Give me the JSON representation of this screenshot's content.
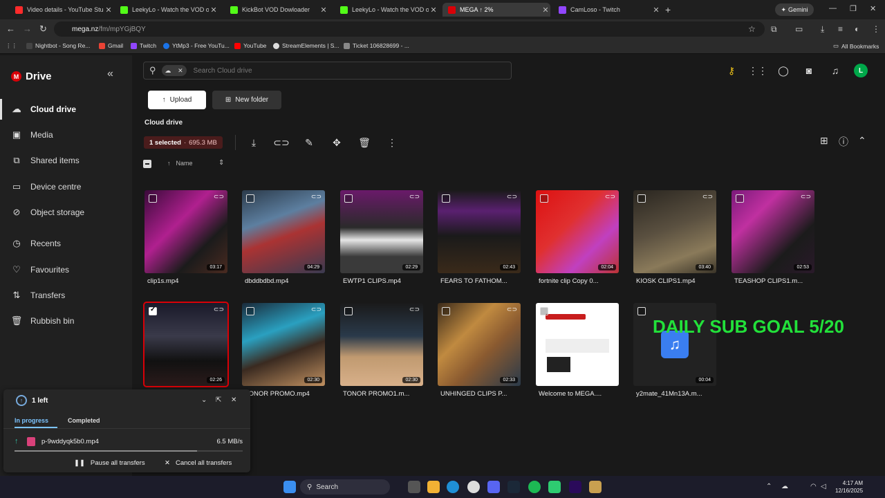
{
  "browser": {
    "tabs": [
      {
        "title": "Video details - YouTube Studio",
        "color": "#ff2b2b"
      },
      {
        "title": "LeekyLo - Watch the VOD on K",
        "color": "#53fc18"
      },
      {
        "title": "KickBot VOD Dowloader",
        "color": "#53fc18"
      },
      {
        "title": "LeekyLo - Watch the VOD on K",
        "color": "#53fc18"
      },
      {
        "title": "MEGA ↑ 2%",
        "color": "#d90007"
      },
      {
        "title": "CamLoso - Twitch",
        "color": "#9146ff"
      }
    ],
    "gemini_label": "Gemini",
    "url_host": "mega.nz",
    "url_path": "/fm/mpYGjBQY",
    "bookmarks": [
      {
        "label": "Nightbot - Song Re...",
        "color": "#2d2d2d"
      },
      {
        "label": "Gmail",
        "color": "#ea4335"
      },
      {
        "label": "Twitch",
        "color": "#9146ff"
      },
      {
        "label": "YtMp3 - Free YouTu...",
        "color": "#1a73e8"
      },
      {
        "label": "YouTube",
        "color": "#ff0000"
      },
      {
        "label": "StreamElements | S...",
        "color": "#ddd"
      },
      {
        "label": "Ticket 106828699 - ...",
        "color": "#888"
      }
    ],
    "all_bookmarks": "All Bookmarks"
  },
  "sidebar": {
    "brand": "Drive",
    "items": [
      {
        "label": "Cloud drive",
        "icon": "cloud-icon"
      },
      {
        "label": "Media",
        "icon": "image-icon"
      },
      {
        "label": "Shared items",
        "icon": "shared-icon"
      },
      {
        "label": "Device centre",
        "icon": "device-icon"
      },
      {
        "label": "Object storage",
        "icon": "storage-icon"
      },
      {
        "label": "Recents",
        "icon": "clock-icon"
      },
      {
        "label": "Favourites",
        "icon": "heart-icon"
      },
      {
        "label": "Transfers",
        "icon": "transfer-icon"
      },
      {
        "label": "Rubbish bin",
        "icon": "trash-icon"
      }
    ]
  },
  "search": {
    "placeholder": "Search Cloud drive"
  },
  "actions": {
    "upload": "Upload",
    "new_folder": "New folder"
  },
  "breadcrumb": "Cloud drive",
  "selection": {
    "count": "1 selected",
    "size": "695.3 MB"
  },
  "sort_label": "Name",
  "files": [
    {
      "name": "clip1s.mp4",
      "duration": "03:17",
      "checked": false
    },
    {
      "name": "dbddbdbd.mp4",
      "duration": "04:29",
      "checked": false
    },
    {
      "name": "EWTP1 CLIPS.mp4",
      "duration": "02:29",
      "checked": false
    },
    {
      "name": "FEARS TO FATHOM...",
      "duration": "02:43",
      "checked": false
    },
    {
      "name": "fortnite clip Copy 0...",
      "duration": "02:04",
      "checked": false
    },
    {
      "name": "KIOSK CLIPS1.mp4",
      "duration": "03:40",
      "checked": false
    },
    {
      "name": "TEASHOP CLIPS1.m...",
      "duration": "02:53",
      "checked": false
    },
    {
      "name": "",
      "duration": "02:26",
      "checked": true
    },
    {
      "name": "TONOR PROMO.mp4",
      "duration": "02:30",
      "checked": false
    },
    {
      "name": "TONOR PROMO1.m...",
      "duration": "02:30",
      "checked": false
    },
    {
      "name": "UNHINGED CLIPS P...",
      "duration": "02:33",
      "checked": false
    },
    {
      "name": "Welcome to MEGA....",
      "duration": "",
      "checked": false
    },
    {
      "name": "y2mate_41Mn13A.m...",
      "duration": "00:04",
      "checked": false
    }
  ],
  "overlay_text": "DAILY SUB GOAL 5/20",
  "transfers": {
    "header": "1 left",
    "tab_in_progress": "In progress",
    "tab_completed": "Completed",
    "file": "p-9wddyqk5b0.mp4",
    "speed": "6.5 MB/s",
    "progress": 0.8,
    "pause_all": "Pause all transfers",
    "cancel_all": "Cancel all transfers"
  },
  "taskbar": {
    "search": "Search",
    "time": "4:17 AM",
    "date": "12/16/2025"
  }
}
